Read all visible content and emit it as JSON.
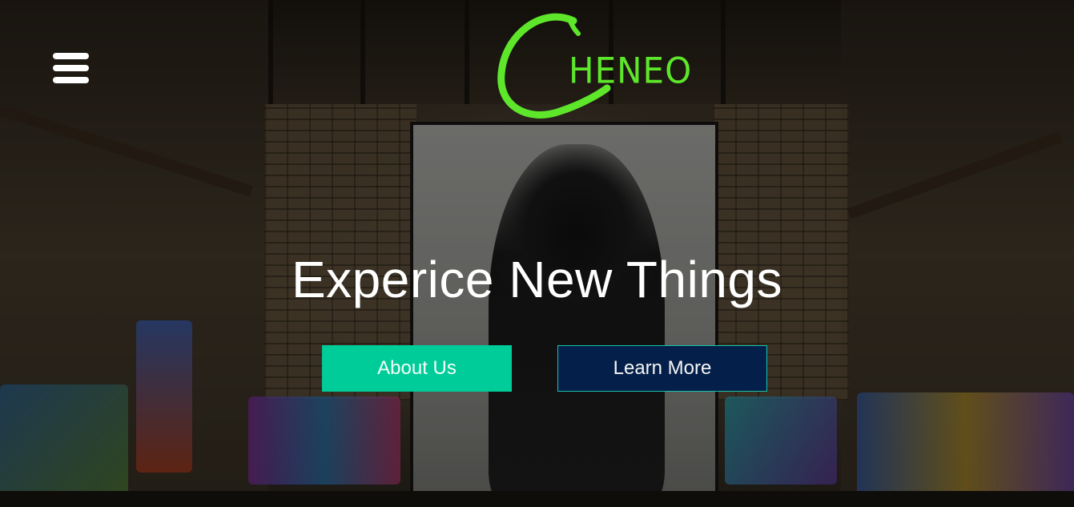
{
  "header": {
    "menu_icon": "hamburger-menu-icon",
    "logo": {
      "initial": "C",
      "rest": "HENEO",
      "color": "#5ee62b"
    }
  },
  "hero": {
    "headline": "Experice New Things",
    "buttons": {
      "about_label": "About Us",
      "learn_label": "Learn More"
    }
  },
  "colors": {
    "about_bg": "#00cc99",
    "learn_bg": "#04204a",
    "learn_border": "#19c3a4",
    "text": "#ffffff"
  }
}
